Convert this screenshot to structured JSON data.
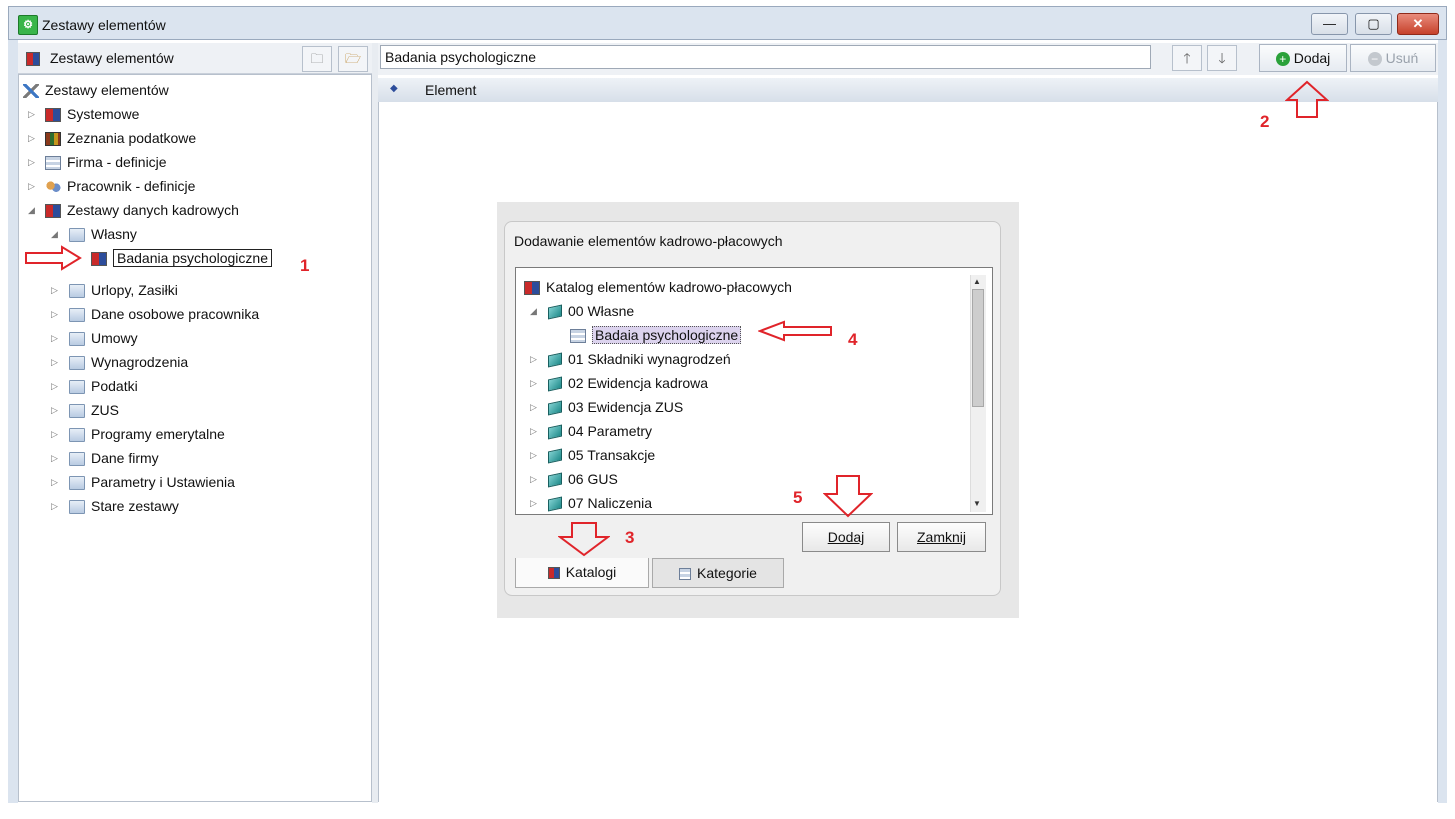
{
  "window": {
    "title": "Zestawy elementów",
    "minimize": "—",
    "maximize": "▢",
    "close": "✕"
  },
  "left_toolbar": {
    "title": "Zestawy elementów"
  },
  "left_tree": {
    "root": "Zestawy elementów",
    "items": [
      {
        "label": "Systemowe"
      },
      {
        "label": "Zeznania podatkowe"
      },
      {
        "label": "Firma - definicje"
      },
      {
        "label": "Pracownik - definicje"
      },
      {
        "label": "Zestawy danych kadrowych"
      },
      {
        "label": "Własny"
      },
      {
        "label": "Badania psychologiczne"
      },
      {
        "label": "Urlopy, Zasiłki"
      },
      {
        "label": "Dane osobowe pracownika"
      },
      {
        "label": "Umowy"
      },
      {
        "label": "Wynagrodzenia"
      },
      {
        "label": "Podatki"
      },
      {
        "label": "ZUS"
      },
      {
        "label": "Programy emerytalne"
      },
      {
        "label": "Dane firmy"
      },
      {
        "label": "Parametry i Ustawienia"
      },
      {
        "label": "Stare zestawy"
      }
    ]
  },
  "right_panel": {
    "name_value": "Badania psychologiczne",
    "up": "🡑",
    "down": "🡓",
    "add_button": "Dodaj",
    "remove_button": "Usuń",
    "column_header": "Element"
  },
  "dialog": {
    "title": "Dodawanie elementów kadrowo-płacowych",
    "tree_root": "Katalog elementów kadrowo-płacowych",
    "items": [
      {
        "label": "00 Własne"
      },
      {
        "label": "Badaia psychologiczne"
      },
      {
        "label": "01 Składniki wynagrodzeń"
      },
      {
        "label": "02 Ewidencja kadrowa"
      },
      {
        "label": "03 Ewidencja ZUS"
      },
      {
        "label": "04 Parametry"
      },
      {
        "label": "05 Transakcje"
      },
      {
        "label": "06 GUS"
      },
      {
        "label": "07 Naliczenia"
      }
    ],
    "add_button": "Dodaj",
    "close_button": "Zamknij",
    "tab_catalogs": "Katalogi",
    "tab_categories": "Kategorie"
  },
  "annotations": {
    "n1": "1",
    "n2": "2",
    "n3": "3",
    "n4": "4",
    "n5": "5"
  },
  "colors": {
    "annotation_red": "#e0242a",
    "title_bar": "#dbe4ef",
    "add_icon": "#2aa13a"
  }
}
